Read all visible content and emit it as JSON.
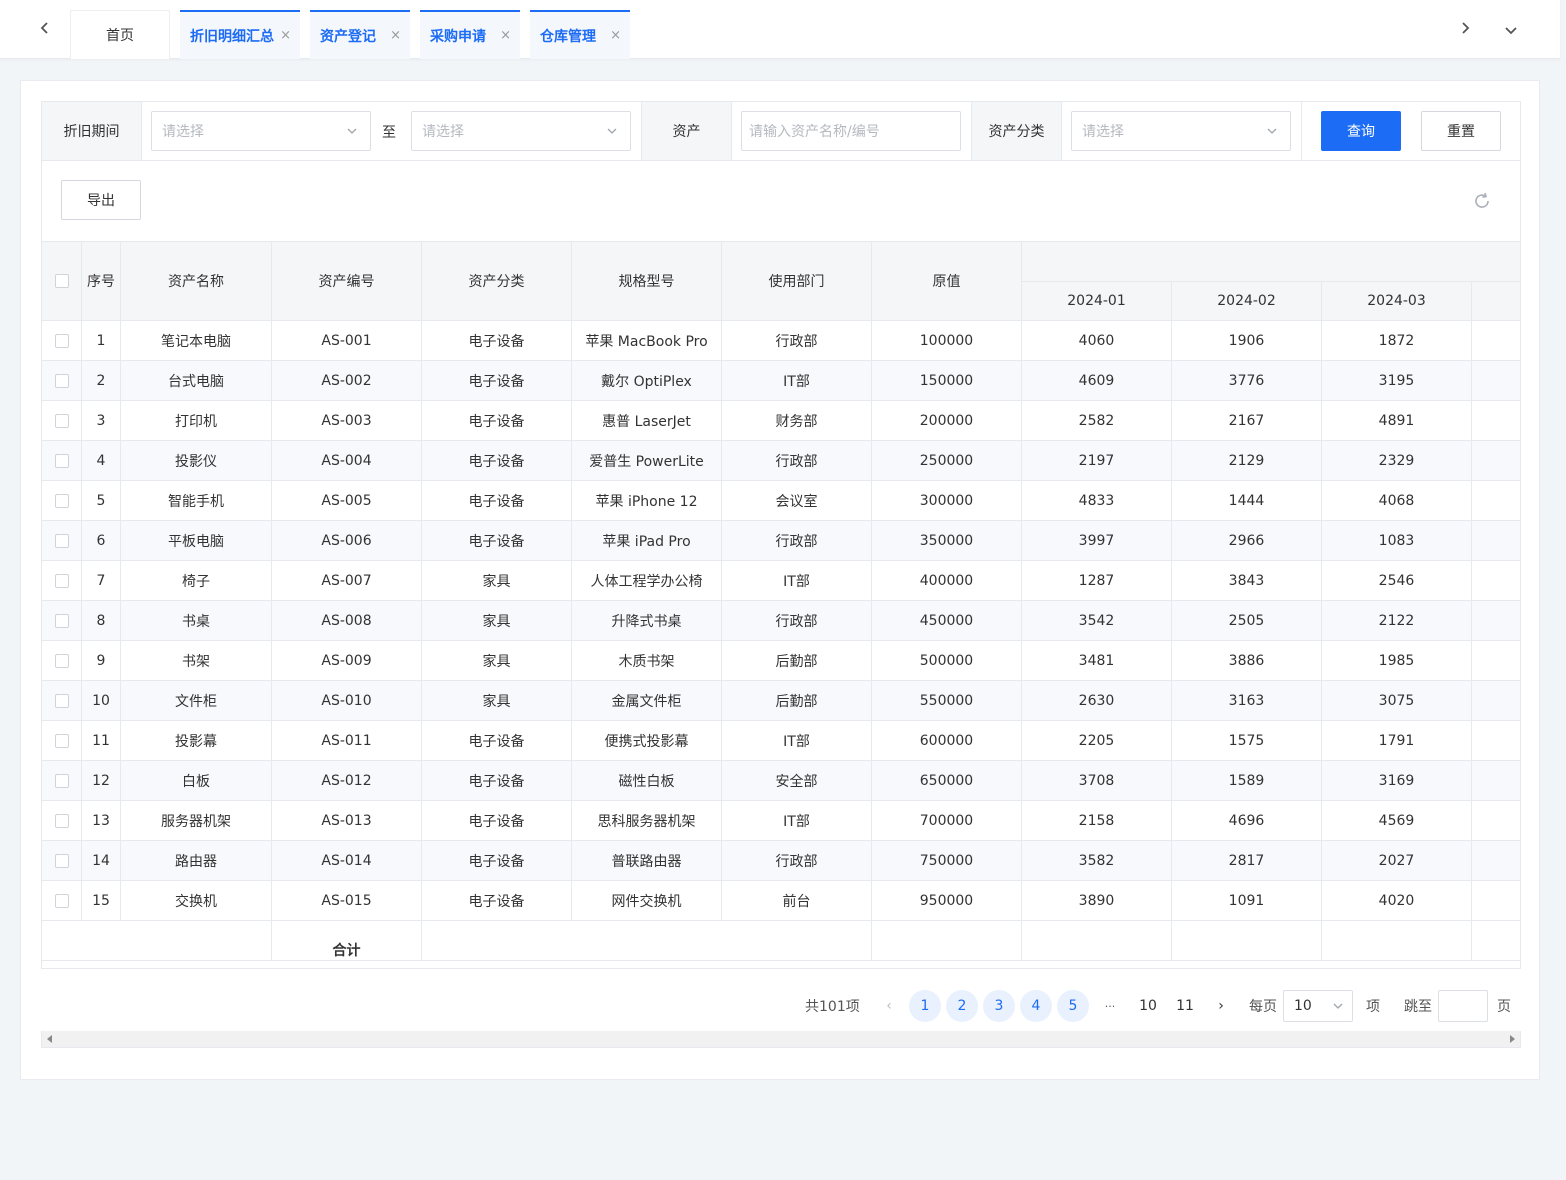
{
  "tabs": {
    "home": "首页",
    "items": [
      {
        "label": "折旧明细汇总",
        "close": "×"
      },
      {
        "label": "资产登记",
        "close": "×"
      },
      {
        "label": "采购申请",
        "close": "×"
      },
      {
        "label": "仓库管理",
        "close": "×"
      }
    ]
  },
  "filter": {
    "period_label": "折旧期间",
    "period_start_placeholder": "请选择",
    "to_label": "至",
    "period_end_placeholder": "请选择",
    "asset_label": "资产",
    "asset_placeholder": "请输入资产名称/编号",
    "category_label": "资产分类",
    "category_placeholder": "请选择",
    "query_button": "查询",
    "reset_button": "重置"
  },
  "toolbar": {
    "export_button": "导出"
  },
  "table": {
    "headers": [
      "序号",
      "资产名称",
      "资产编号",
      "资产分类",
      "规格型号",
      "使用部门",
      "原值"
    ],
    "months": [
      "2024-01",
      "2024-02",
      "2024-03"
    ],
    "rows": [
      {
        "no": "1",
        "name": "笔记本电脑",
        "code": "AS-001",
        "category": "电子设备",
        "model": "苹果 MacBook Pro",
        "dept": "行政部",
        "value": "100000",
        "m": [
          "4060",
          "1906",
          "1872"
        ]
      },
      {
        "no": "2",
        "name": "台式电脑",
        "code": "AS-002",
        "category": "电子设备",
        "model": "戴尔 OptiPlex",
        "dept": "IT部",
        "value": "150000",
        "m": [
          "4609",
          "3776",
          "3195"
        ]
      },
      {
        "no": "3",
        "name": "打印机",
        "code": "AS-003",
        "category": "电子设备",
        "model": "惠普 LaserJet",
        "dept": "财务部",
        "value": "200000",
        "m": [
          "2582",
          "2167",
          "4891"
        ]
      },
      {
        "no": "4",
        "name": "投影仪",
        "code": "AS-004",
        "category": "电子设备",
        "model": "爱普生 PowerLite",
        "dept": "行政部",
        "value": "250000",
        "m": [
          "2197",
          "2129",
          "2329"
        ]
      },
      {
        "no": "5",
        "name": "智能手机",
        "code": "AS-005",
        "category": "电子设备",
        "model": "苹果 iPhone 12",
        "dept": "会议室",
        "value": "300000",
        "m": [
          "4833",
          "1444",
          "4068"
        ]
      },
      {
        "no": "6",
        "name": "平板电脑",
        "code": "AS-006",
        "category": "电子设备",
        "model": "苹果 iPad Pro",
        "dept": "行政部",
        "value": "350000",
        "m": [
          "3997",
          "2966",
          "1083"
        ]
      },
      {
        "no": "7",
        "name": "椅子",
        "code": "AS-007",
        "category": "家具",
        "model": "人体工程学办公椅",
        "dept": "IT部",
        "value": "400000",
        "m": [
          "1287",
          "3843",
          "2546"
        ]
      },
      {
        "no": "8",
        "name": "书桌",
        "code": "AS-008",
        "category": "家具",
        "model": "升降式书桌",
        "dept": "行政部",
        "value": "450000",
        "m": [
          "3542",
          "2505",
          "2122"
        ]
      },
      {
        "no": "9",
        "name": "书架",
        "code": "AS-009",
        "category": "家具",
        "model": "木质书架",
        "dept": "后勤部",
        "value": "500000",
        "m": [
          "3481",
          "3886",
          "1985"
        ]
      },
      {
        "no": "10",
        "name": "文件柜",
        "code": "AS-010",
        "category": "家具",
        "model": "金属文件柜",
        "dept": "后勤部",
        "value": "550000",
        "m": [
          "2630",
          "3163",
          "3075"
        ]
      },
      {
        "no": "11",
        "name": "投影幕",
        "code": "AS-011",
        "category": "电子设备",
        "model": "便携式投影幕",
        "dept": "IT部",
        "value": "600000",
        "m": [
          "2205",
          "1575",
          "1791"
        ]
      },
      {
        "no": "12",
        "name": "白板",
        "code": "AS-012",
        "category": "电子设备",
        "model": "磁性白板",
        "dept": "安全部",
        "value": "650000",
        "m": [
          "3708",
          "1589",
          "3169"
        ]
      },
      {
        "no": "13",
        "name": "服务器机架",
        "code": "AS-013",
        "category": "电子设备",
        "model": "思科服务器机架",
        "dept": "IT部",
        "value": "700000",
        "m": [
          "2158",
          "4696",
          "4569"
        ]
      },
      {
        "no": "14",
        "name": "路由器",
        "code": "AS-014",
        "category": "电子设备",
        "model": "普联路由器",
        "dept": "行政部",
        "value": "750000",
        "m": [
          "3582",
          "2817",
          "2027"
        ]
      },
      {
        "no": "15",
        "name": "交换机",
        "code": "AS-015",
        "category": "电子设备",
        "model": "网件交换机",
        "dept": "前台",
        "value": "950000",
        "m": [
          "3890",
          "1091",
          "4020"
        ]
      }
    ],
    "summary_label": "合计"
  },
  "pagination": {
    "total": "共101项",
    "prev": "‹",
    "pages": [
      "1",
      "2",
      "3",
      "4",
      "5"
    ],
    "ellipsis": "···",
    "last_pages": [
      "10",
      "11"
    ],
    "next": "›",
    "per_page_label": "每页",
    "per_page_value": "10",
    "per_page_unit": "项",
    "jump_label": "跳至",
    "jump_unit": "页"
  }
}
